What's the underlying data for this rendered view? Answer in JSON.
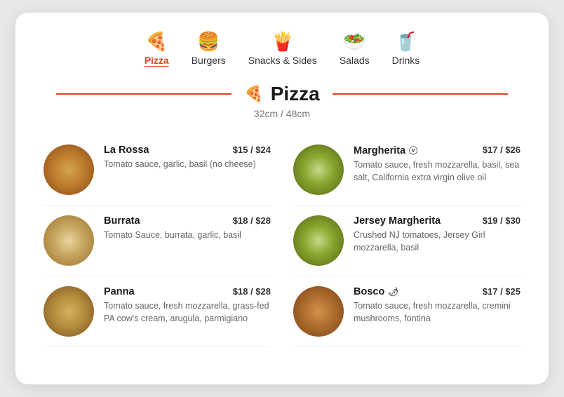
{
  "nav": {
    "items": [
      {
        "id": "pizza",
        "label": "Pizza",
        "icon": "🍕",
        "active": true
      },
      {
        "id": "burgers",
        "label": "Burgers",
        "icon": "🍔",
        "active": false
      },
      {
        "id": "snacks",
        "label": "Snacks & Sides",
        "icon": "🍟",
        "active": false
      },
      {
        "id": "salads",
        "label": "Salads",
        "icon": "🥗",
        "active": false
      },
      {
        "id": "drinks",
        "label": "Drinks",
        "icon": "🥤",
        "active": false
      }
    ]
  },
  "section": {
    "title": "Pizza",
    "icon": "🍕",
    "subtitle": "32cm / 48cm"
  },
  "menu_items": [
    {
      "id": "la-rossa",
      "name": "La Rossa",
      "price": "$15 / $24",
      "description": "Tomato sauce, garlic, basil (no cheese)",
      "badge": "",
      "img_class": "pizza-1"
    },
    {
      "id": "margherita",
      "name": "Margherita",
      "price": "$17 / $26",
      "description": "Tomato sauce, fresh mozzarella, basil, sea salt, California extra virgin olive oil",
      "badge": "ⓥ",
      "img_class": "pizza-4"
    },
    {
      "id": "burrata",
      "name": "Burrata",
      "price": "$18 / $28",
      "description": "Tomato Sauce, burrata, garlic, basil",
      "badge": "",
      "img_class": "pizza-2"
    },
    {
      "id": "jersey-margherita",
      "name": "Jersey Margherita",
      "price": "$19 / $30",
      "description": "Crushed NJ tomatoes, Jersey Girl mozzarella, basil",
      "badge": "",
      "img_class": "pizza-4"
    },
    {
      "id": "panna",
      "name": "Panna",
      "price": "$18 / $28",
      "description": "Tomato sauce, fresh mozzarella, grass-fed PA cow's cream, arugula, parmigiano",
      "badge": "",
      "img_class": "pizza-3"
    },
    {
      "id": "bosco",
      "name": "Bosco",
      "price": "$17 / $25",
      "description": "Tomato sauce, fresh mozzarella, cremini mushrooms, fontina",
      "badge": "🌶",
      "img_class": "pizza-6"
    }
  ],
  "colors": {
    "accent": "#e0451a"
  }
}
